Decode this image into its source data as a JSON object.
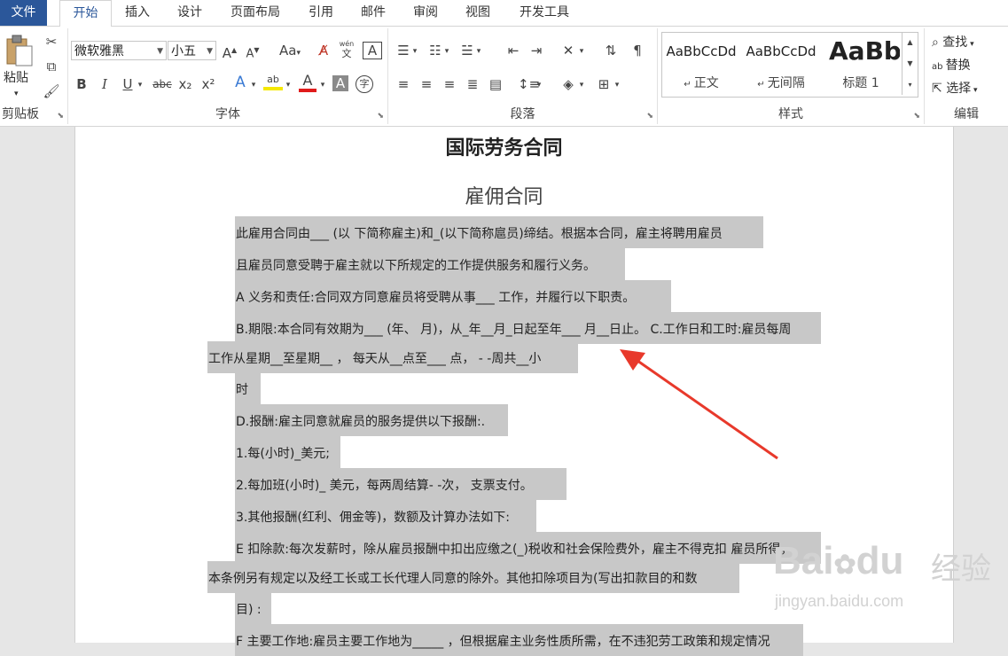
{
  "tabs": {
    "file": "文件",
    "home": "开始",
    "insert": "插入",
    "design": "设计",
    "layout": "页面布局",
    "references": "引用",
    "mailings": "邮件",
    "review": "审阅",
    "view": "视图",
    "developer": "开发工具"
  },
  "clipboard": {
    "paste": "粘贴",
    "group_label": "剪贴板"
  },
  "font": {
    "name": "微软雅黑",
    "size": "小五",
    "aa_label": "Aa",
    "wen_label": "wén",
    "wen_char": "文",
    "border_char": "A",
    "bold": "B",
    "italic": "I",
    "underline": "U",
    "strike": "abc",
    "subscript": "x₂",
    "superscript": "x²",
    "effect": "A",
    "highlight": "ab",
    "color": "A",
    "shade": "A",
    "circle": "字",
    "group_label": "字体"
  },
  "paragraph": {
    "group_label": "段落"
  },
  "styles": {
    "items": [
      {
        "preview": "AaBbCcDd",
        "name": "正文"
      },
      {
        "preview": "AaBbCcDd",
        "name": "无间隔"
      },
      {
        "preview": "AaBb",
        "name": "标题 1"
      }
    ],
    "group_label": "样式"
  },
  "editing": {
    "find": "查找",
    "replace": "替换",
    "select": "选择",
    "group_label": "编辑"
  },
  "document": {
    "title": "国际劳务合同",
    "subtitle": "雇佣合同",
    "lines": [
      "此雇用合同由___ (以  下简称雇主)和_(以下简称扈员)缔结。根据本合同，雇主将聘用雇员",
      "且雇员同意受聘于雇主就以下所规定的工作提供服务和履行义务。",
      "A 义务和责任:合同双方同意雇员将受聘从事___  工作，并履行以下职责。",
      "B.期限:本合同有效期为___ (年、  月)，从_年__月_日起至年___  月__日止。   C.工作日和工时:雇员每周",
      "工作从星期__至星期__ ，   每天从__点至___  点，   - -周共__小",
      "时",
      "D.报酬:雇主同意就雇员的服务提供以下报酬:.",
      "1.每(小时)_美元;",
      "2.每加班(小时)_ 美元，每两周结算- -次，   支票支付。",
      "3.其他报酬(红利、佣金等)，数额及计算办法如下:",
      "E 扣除款:每次发薪时，除从雇员报酬中扣出应缴之(_)税收和社会保险费外，雇主不得克扣  雇员所得，",
      "本条例另有规定以及经工长或工长代理人同意的除外。其他扣除项目为(写出扣款目的和数",
      "目) :",
      "F 主要工作地:雇员主要工作地为_____ ，但根据雇主业务性质所需，在不违犯劳工政策和规定情况"
    ]
  },
  "watermark": {
    "brand": "Bai",
    "brand2": "du",
    "cn": "经验",
    "url": "jingyan.baidu.com"
  },
  "colors": {
    "file_tab": "#2b579a",
    "highlight": "#c8c8c8",
    "arrow": "#e8392b"
  }
}
